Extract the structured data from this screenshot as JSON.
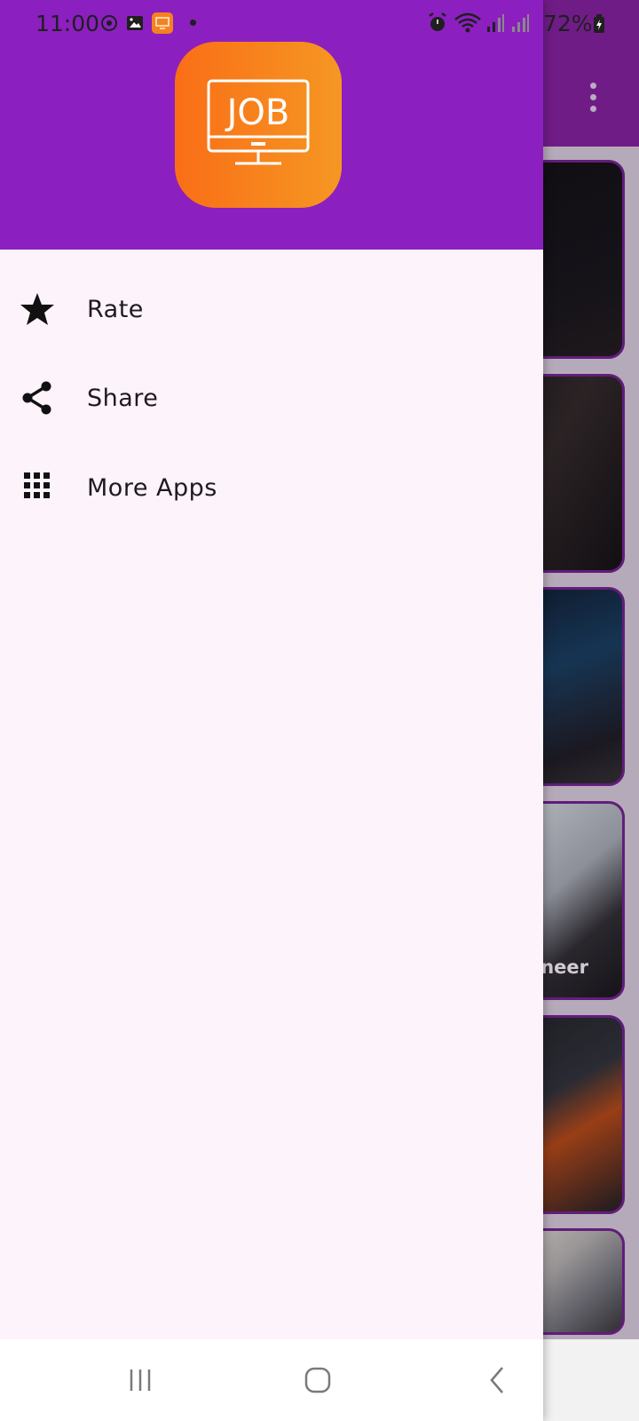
{
  "status_bar": {
    "time": "11:00",
    "battery": "72%"
  },
  "drawer": {
    "logo_text": "JOB",
    "menu": [
      {
        "label": "Rate",
        "icon": "star-icon"
      },
      {
        "label": "Share",
        "icon": "share-icon"
      },
      {
        "label": "More Apps",
        "icon": "apps-grid-icon"
      }
    ]
  },
  "background": {
    "card_caption": "gineer"
  },
  "colors": {
    "drawer_header": "#8c1fbf",
    "drawer_body": "#fdf3fb",
    "logo_gradient_start": "#fa6e16",
    "logo_gradient_end": "#f59723",
    "card_border": "#6a1f86"
  }
}
